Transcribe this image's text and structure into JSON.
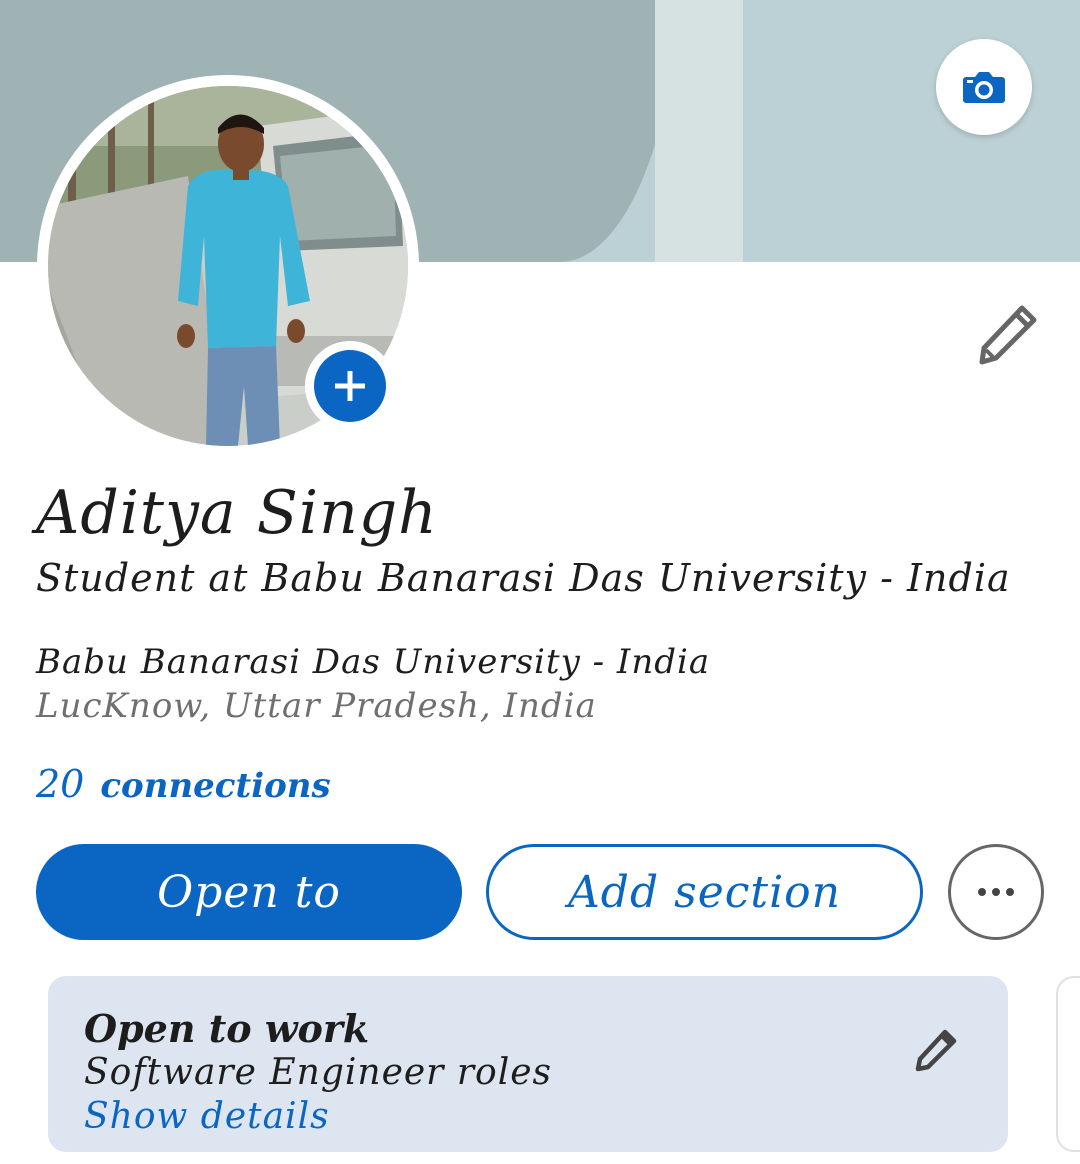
{
  "profile": {
    "name": "Aditya Singh",
    "headline": "Student at Babu Banarasi Das University - India",
    "school": "Babu Banarasi Das University - India",
    "location": "LucKnow, Uttar Pradesh, India",
    "connections_count": "20",
    "connections_label": "connections"
  },
  "actions": {
    "open_to_label": "Open to",
    "add_section_label": "Add section"
  },
  "open_to_work": {
    "title": "Open to work",
    "roles": "Software Engineer roles",
    "details_link": "Show details"
  },
  "icons": {
    "banner_edit": "camera-icon",
    "add_photo": "plus-icon",
    "edit_intro": "pencil-icon",
    "more": "ellipsis-icon",
    "otw_edit": "pencil-icon"
  },
  "colors": {
    "accent": "#0a66c2",
    "banner_dark": "#9fb2b4",
    "banner_light": "#bcd1d5",
    "card_bg": "#dde6f0"
  }
}
